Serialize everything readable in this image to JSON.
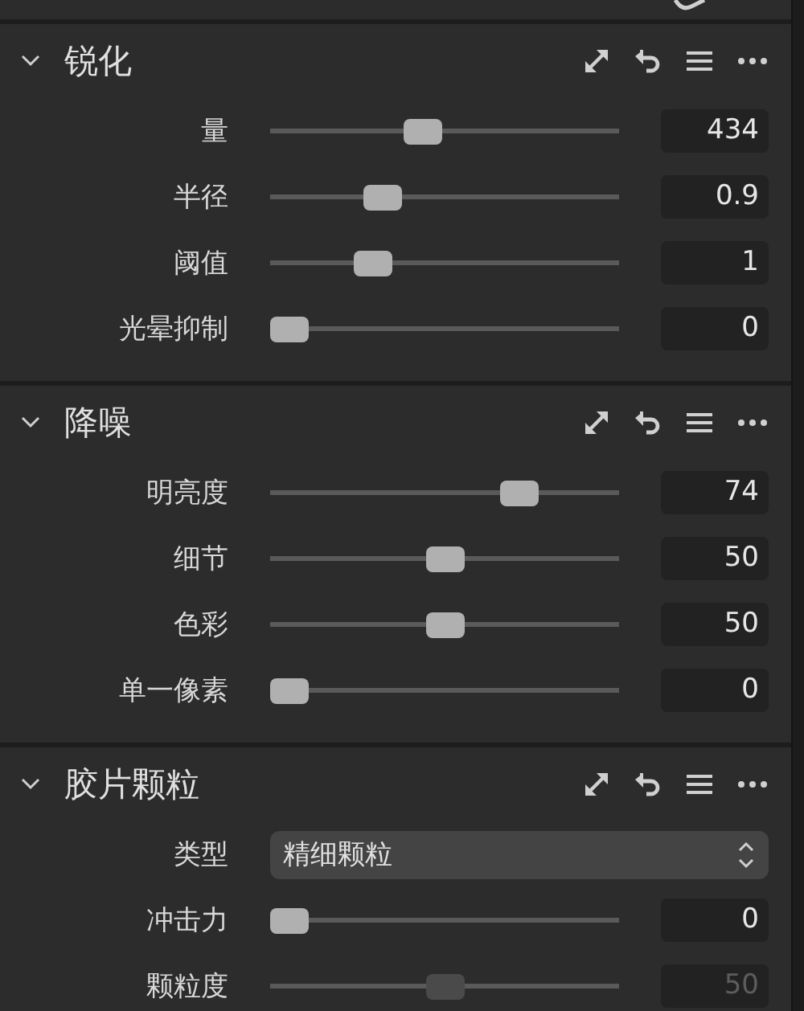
{
  "sections": [
    {
      "title": "锐化",
      "expanded": true,
      "rows": [
        {
          "kind": "slider",
          "label": "量",
          "level": 0.43,
          "value": "434",
          "disabled": false
        },
        {
          "kind": "slider",
          "label": "半径",
          "level": 0.3,
          "value": "0.9",
          "disabled": false
        },
        {
          "kind": "slider",
          "label": "阈值",
          "level": 0.27,
          "value": "1",
          "disabled": false
        },
        {
          "kind": "slider",
          "label": "光晕抑制",
          "level": 0,
          "value": "0",
          "disabled": false
        }
      ]
    },
    {
      "title": "降噪",
      "expanded": true,
      "rows": [
        {
          "kind": "slider",
          "label": "明亮度",
          "level": 0.74,
          "value": "74",
          "disabled": false
        },
        {
          "kind": "slider",
          "label": "细节",
          "level": 0.5,
          "value": "50",
          "disabled": false
        },
        {
          "kind": "slider",
          "label": "色彩",
          "level": 0.5,
          "value": "50",
          "disabled": false
        },
        {
          "kind": "slider",
          "label": "单一像素",
          "level": 0,
          "value": "0",
          "disabled": false
        }
      ]
    },
    {
      "title": "胶片颗粒",
      "expanded": true,
      "rows": [
        {
          "kind": "select",
          "label": "类型",
          "value": "精细颗粒"
        },
        {
          "kind": "slider",
          "label": "冲击力",
          "level": 0,
          "value": "0",
          "disabled": false
        },
        {
          "kind": "slider",
          "label": "颗粒度",
          "level": 0.5,
          "value": "50",
          "disabled": true
        }
      ]
    }
  ]
}
